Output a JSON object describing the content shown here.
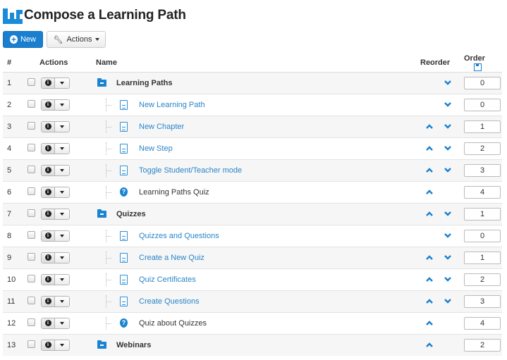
{
  "header": {
    "title": "Compose a Learning Path"
  },
  "toolbar": {
    "new_label": "New",
    "actions_label": "Actions"
  },
  "table": {
    "headers": {
      "num": "#",
      "actions": "Actions",
      "name": "Name",
      "reorder": "Reorder",
      "order": "Order"
    },
    "rows": [
      {
        "num": "1",
        "type": "folder",
        "name": "Learning Paths",
        "up": false,
        "down": true,
        "order": "0"
      },
      {
        "num": "2",
        "type": "doc",
        "name": "New Learning Path",
        "up": false,
        "down": true,
        "order": "0"
      },
      {
        "num": "3",
        "type": "doc",
        "name": "New Chapter",
        "up": true,
        "down": true,
        "order": "1"
      },
      {
        "num": "4",
        "type": "doc",
        "name": "New Step",
        "up": true,
        "down": true,
        "order": "2"
      },
      {
        "num": "5",
        "type": "doc",
        "name": "Toggle Student/Teacher mode",
        "up": true,
        "down": true,
        "order": "3"
      },
      {
        "num": "6",
        "type": "quiz",
        "name": "Learning Paths Quiz",
        "up": true,
        "down": false,
        "order": "4"
      },
      {
        "num": "7",
        "type": "folder",
        "name": "Quizzes",
        "up": true,
        "down": true,
        "order": "1"
      },
      {
        "num": "8",
        "type": "doc",
        "name": "Quizzes and Questions",
        "up": false,
        "down": true,
        "order": "0"
      },
      {
        "num": "9",
        "type": "doc",
        "name": "Create a New Quiz",
        "up": true,
        "down": true,
        "order": "1"
      },
      {
        "num": "10",
        "type": "doc",
        "name": "Quiz Certificates",
        "up": true,
        "down": true,
        "order": "2"
      },
      {
        "num": "11",
        "type": "doc",
        "name": "Create Questions",
        "up": true,
        "down": true,
        "order": "3"
      },
      {
        "num": "12",
        "type": "quiz",
        "name": "Quiz about Quizzes",
        "up": true,
        "down": false,
        "order": "4"
      },
      {
        "num": "13",
        "type": "folder",
        "name": "Webinars",
        "up": true,
        "down": false,
        "order": "2"
      }
    ]
  },
  "colors": {
    "accent": "#1a7fcf",
    "link": "#2a85c9"
  }
}
